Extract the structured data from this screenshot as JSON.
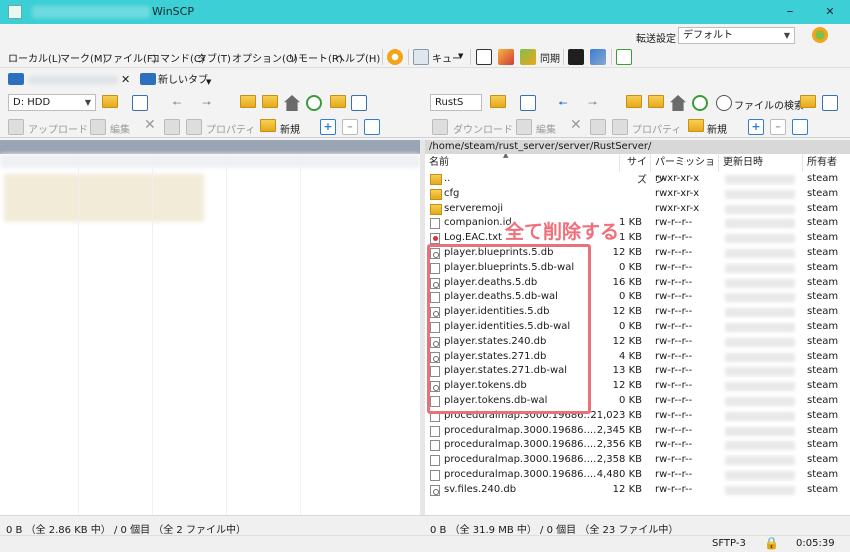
{
  "window": {
    "title": "WinSCP"
  },
  "menu": {
    "items": [
      "ローカル(L)",
      "マーク(M)",
      "ファイル(F)",
      "コマンド(C)",
      "タブ(T)",
      "オプション(O)",
      "リモート(R)",
      "ヘルプ(H)"
    ],
    "queue_label": "キュー",
    "sync_label": "同期",
    "transfer_settings_label": "転送設定",
    "transfer_settings_value": "デフォルト"
  },
  "tabs": {
    "new_tab_label": "新しいタブ"
  },
  "left_toolbar": {
    "drive": "D: HDD",
    "upload": "アップロード",
    "edit": "編集",
    "properties": "プロパティ",
    "new": "新規"
  },
  "right_toolbar": {
    "drive": "RustS",
    "find_files": "ファイルの検索",
    "download": "ダウンロード",
    "edit": "編集",
    "properties": "プロパティ",
    "new": "新規"
  },
  "remote": {
    "path": "/home/steam/rust_server/server/RustServer/",
    "columns": {
      "name": "名前",
      "size": "サイズ",
      "permissions": "パーミッション",
      "modified": "更新日時",
      "owner": "所有者"
    },
    "files": [
      {
        "name": "..",
        "size": "",
        "perm": "rwxr-xr-x",
        "owner": "steam",
        "type": "dir"
      },
      {
        "name": "cfg",
        "size": "",
        "perm": "rwxr-xr-x",
        "owner": "steam",
        "type": "dir"
      },
      {
        "name": "serveremoji",
        "size": "",
        "perm": "rwxr-xr-x",
        "owner": "steam",
        "type": "dir"
      },
      {
        "name": "companion.id",
        "size": "1 KB",
        "perm": "rw-r--r--",
        "owner": "steam",
        "type": "file"
      },
      {
        "name": "Log.EAC.txt",
        "size": "1 KB",
        "perm": "rw-r--r--",
        "owner": "steam",
        "type": "log"
      },
      {
        "name": "player.blueprints.5.db",
        "size": "12 KB",
        "perm": "rw-r--r--",
        "owner": "steam",
        "type": "db"
      },
      {
        "name": "player.blueprints.5.db-wal",
        "size": "0 KB",
        "perm": "rw-r--r--",
        "owner": "steam",
        "type": "file"
      },
      {
        "name": "player.deaths.5.db",
        "size": "16 KB",
        "perm": "rw-r--r--",
        "owner": "steam",
        "type": "db"
      },
      {
        "name": "player.deaths.5.db-wal",
        "size": "0 KB",
        "perm": "rw-r--r--",
        "owner": "steam",
        "type": "file"
      },
      {
        "name": "player.identities.5.db",
        "size": "12 KB",
        "perm": "rw-r--r--",
        "owner": "steam",
        "type": "db"
      },
      {
        "name": "player.identities.5.db-wal",
        "size": "0 KB",
        "perm": "rw-r--r--",
        "owner": "steam",
        "type": "file"
      },
      {
        "name": "player.states.240.db",
        "size": "12 KB",
        "perm": "rw-r--r--",
        "owner": "steam",
        "type": "db"
      },
      {
        "name": "player.states.271.db",
        "size": "4 KB",
        "perm": "rw-r--r--",
        "owner": "steam",
        "type": "db"
      },
      {
        "name": "player.states.271.db-wal",
        "size": "13 KB",
        "perm": "rw-r--r--",
        "owner": "steam",
        "type": "file"
      },
      {
        "name": "player.tokens.db",
        "size": "12 KB",
        "perm": "rw-r--r--",
        "owner": "steam",
        "type": "db"
      },
      {
        "name": "player.tokens.db-wal",
        "size": "0 KB",
        "perm": "rw-r--r--",
        "owner": "steam",
        "type": "file"
      },
      {
        "name": "proceduralmap.3000.19686....",
        "size": "21,023 KB",
        "perm": "rw-r--r--",
        "owner": "steam",
        "type": "file"
      },
      {
        "name": "proceduralmap.3000.19686....",
        "size": "2,345 KB",
        "perm": "rw-r--r--",
        "owner": "steam",
        "type": "file"
      },
      {
        "name": "proceduralmap.3000.19686....",
        "size": "2,356 KB",
        "perm": "rw-r--r--",
        "owner": "steam",
        "type": "file"
      },
      {
        "name": "proceduralmap.3000.19686....",
        "size": "2,358 KB",
        "perm": "rw-r--r--",
        "owner": "steam",
        "type": "file"
      },
      {
        "name": "proceduralmap.3000.19686....",
        "size": "4,480 KB",
        "perm": "rw-r--r--",
        "owner": "steam",
        "type": "file"
      },
      {
        "name": "sv.files.240.db",
        "size": "12 KB",
        "perm": "rw-r--r--",
        "owner": "steam",
        "type": "db"
      }
    ]
  },
  "annotation": {
    "text": "全て削除する",
    "color": "#f06f7a"
  },
  "status": {
    "left": "0 B （全 2.86 KB 中） / 0 個目 （全 2 ファイル中）",
    "right": "0 B （全 31.9 MB 中） / 0 個目 （全 23 ファイル中）",
    "protocol": "SFTP-3",
    "elapsed": "0:05:39"
  },
  "colors": {
    "titlebar": "#3ccfd6",
    "highlight": "#e8717a"
  }
}
